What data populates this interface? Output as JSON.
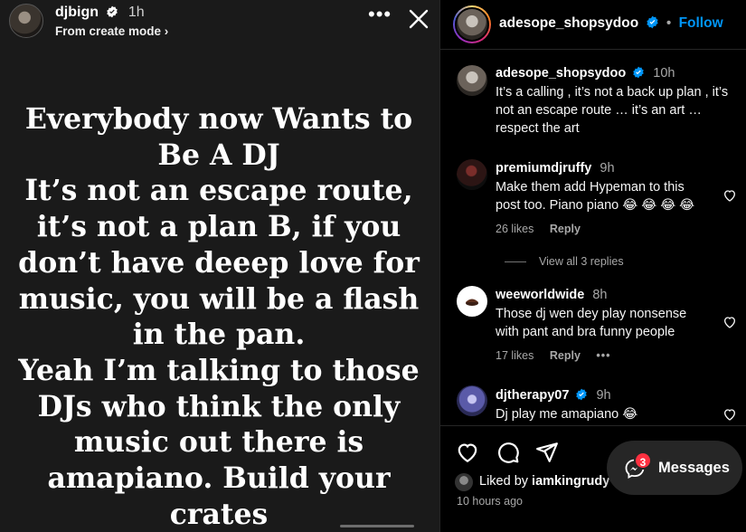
{
  "story": {
    "username": "djbign",
    "time": "1h",
    "subtitle": "From create mode ›",
    "more_icon": "more-horizontal-icon",
    "close_icon": "close-icon",
    "text_lines": [
      "Everybody now Wants to",
      "Be A DJ",
      "It’s not an escape route,",
      "it’s not a plan B, if you",
      "don’t have deeep love for",
      "music, you will be a flash",
      "in the pan.",
      "Yeah I’m talking to those",
      "DJs who think the only",
      "music out there is",
      "amapiano. Build your",
      "crates"
    ]
  },
  "panel": {
    "header": {
      "username": "adesope_shopsydoo",
      "separator": "•",
      "follow_label": "Follow"
    },
    "comments": [
      {
        "username": "adesope_shopsydoo",
        "verified": true,
        "time": "10h",
        "lines": [
          "It’s a calling , it’s not a back up plan , it’s",
          "not an escape route … it’s an art …",
          "respect the art"
        ]
      },
      {
        "username": "premiumdjruffy",
        "time": "9h",
        "lines": [
          "Make them add Hypeman to this",
          "post too. Piano piano 😂 😂 😂 😂"
        ],
        "likes": "26 likes",
        "reply": "Reply",
        "view_replies": "View all 3 replies"
      },
      {
        "username": "weeworldwide",
        "time": "8h",
        "lines": [
          "Those dj wen dey play nonsense",
          "with pant and bra funny people"
        ],
        "likes": "17 likes",
        "reply": "Reply",
        "more": "•••"
      },
      {
        "username": "djtherapy07",
        "verified": true,
        "time": "9h",
        "lines": [
          "Dj play me amapiano 😂"
        ]
      }
    ],
    "liked_by_prefix": "Liked by ",
    "liked_by_user": "iamkingrudy",
    "posted_ago": "10 hours ago"
  },
  "messages": {
    "label": "Messages",
    "badge_count": "3"
  },
  "colors": {
    "accent_blue": "#0095f6",
    "badge_red": "#ff3040",
    "story_bg": "#1a1a1a",
    "panel_bg": "#000000"
  }
}
